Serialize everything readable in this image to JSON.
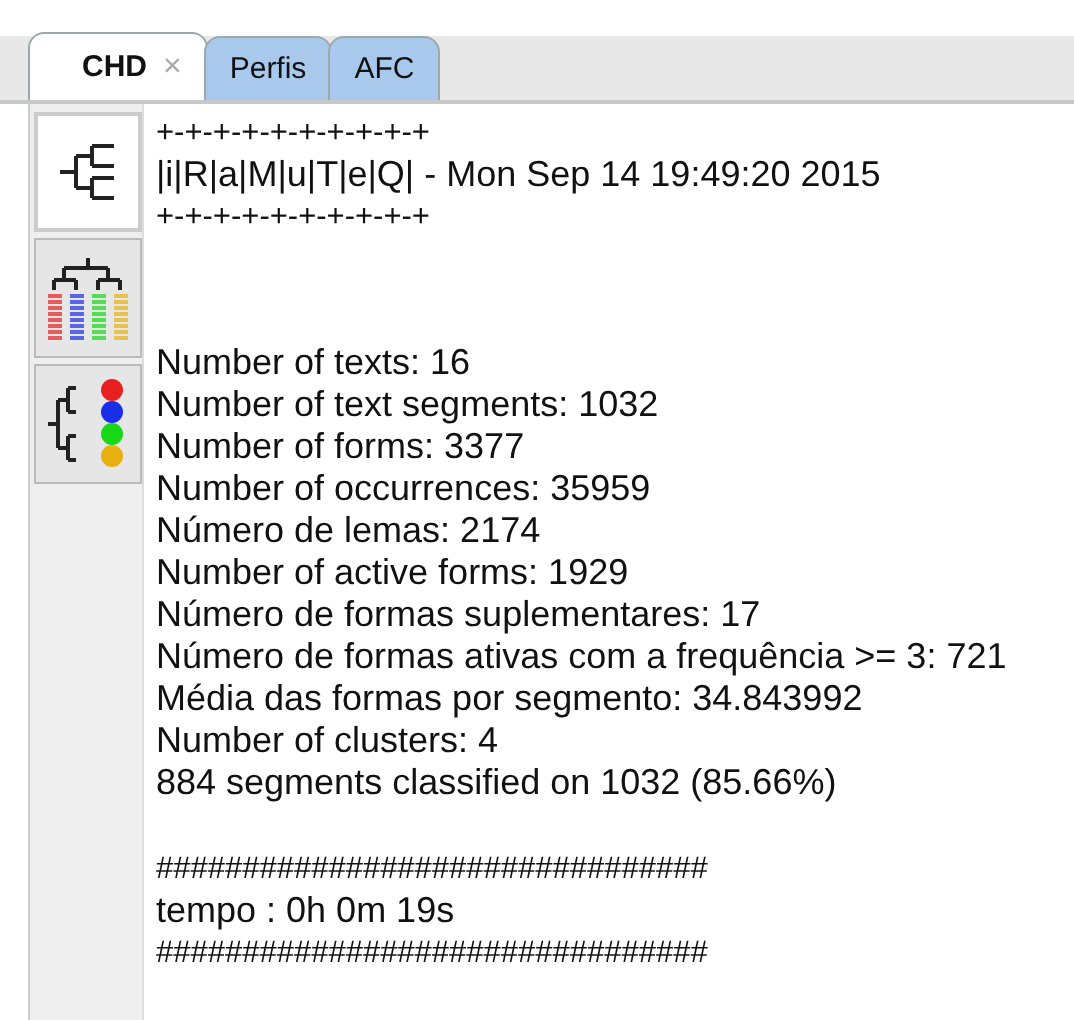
{
  "tabs": [
    {
      "label": "CHD",
      "selected": true,
      "close": "×"
    },
    {
      "label": "Perfis",
      "selected": false
    },
    {
      "label": "AFC",
      "selected": false
    }
  ],
  "toolbar": [
    {
      "kind": "dendrogram",
      "selected": true
    },
    {
      "kind": "profiles",
      "selected": false
    },
    {
      "kind": "clusters",
      "selected": false
    }
  ],
  "header": [
    "+-+-+-+-+-+-+-+-+-+",
    "|i|R|a|M|u|T|e|Q| - Mon Sep 14 19:49:20 2015",
    "+-+-+-+-+-+-+-+-+-+"
  ],
  "stats": [
    "Number of texts: 16",
    "Number of text segments: 1032",
    "Number of forms: 3377",
    "Number of occurrences: 35959",
    "Número de lemas: 2174",
    "Number of active forms: 1929",
    "Número de formas suplementares: 17",
    "Número de formas ativas com a frequência >= 3: 721",
    "Média das formas por segmento: 34.843992",
    "Number of clusters: 4",
    "884 segments classified on 1032 (85.66%)"
  ],
  "footer": [
    "################################",
    "tempo : 0h 0m 19s",
    "################################"
  ]
}
